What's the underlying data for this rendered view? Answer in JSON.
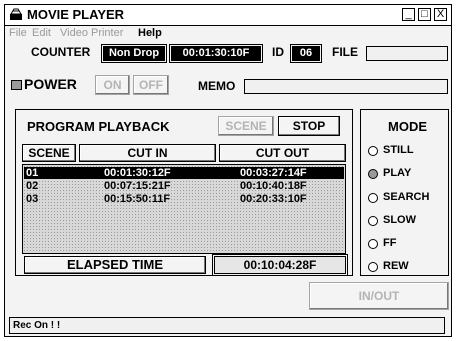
{
  "window": {
    "title": "MOVIE PLAYER",
    "controls": [
      "_",
      "□",
      "X"
    ]
  },
  "menu": [
    "File",
    "Edit",
    "Video Printer",
    "Help"
  ],
  "counter": {
    "label": "COUNTER",
    "mode": "Non Drop",
    "time": "00:01:30:10F"
  },
  "id": {
    "label": "ID",
    "value": "06"
  },
  "file": {
    "label": "FILE",
    "value": ""
  },
  "power": {
    "label": "POWER",
    "on": "ON",
    "off": "OFF"
  },
  "memo": {
    "label": "MEMO",
    "value": ""
  },
  "program": {
    "title": "PROGRAM PLAYBACK",
    "scene_button": "SCENE",
    "stop_button": "STOP",
    "headers": [
      "SCENE",
      "CUT IN",
      "CUT OUT"
    ],
    "rows": [
      {
        "scene": "01",
        "cut_in": "00:01:30:12F",
        "cut_out": "00:03:27:14F",
        "selected": true
      },
      {
        "scene": "02",
        "cut_in": "00:07:15:21F",
        "cut_out": "00:10:40:18F",
        "selected": false
      },
      {
        "scene": "03",
        "cut_in": "00:15:50:11F",
        "cut_out": "00:20:33:10F",
        "selected": false
      }
    ],
    "elapsed_label": "ELAPSED TIME",
    "elapsed_value": "00:10:04:28F"
  },
  "mode": {
    "title": "MODE",
    "options": [
      "STILL",
      "PLAY",
      "SEARCH",
      "SLOW",
      "FF",
      "REW"
    ],
    "selected": "PLAY"
  },
  "inout_button": "IN/OUT",
  "status": "Rec On ! !",
  "colors": {
    "background": "#f3f3f3",
    "selected_row": "#000000",
    "disabled_text": "#b4b4b4"
  }
}
